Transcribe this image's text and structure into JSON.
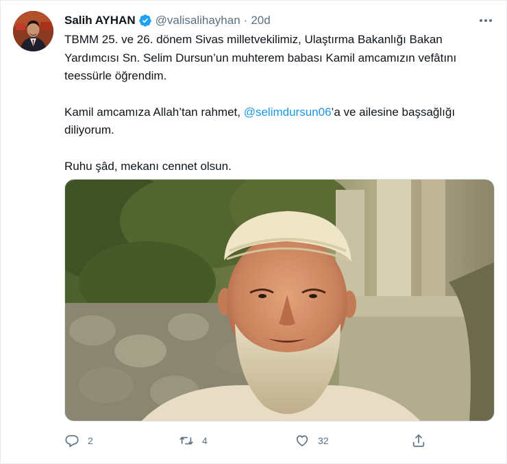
{
  "author": {
    "name": "Salih AYHAN",
    "handle": "@valisalihayhan",
    "separator": "·",
    "time": "20d",
    "verified": true,
    "avatar_icon": "profile-photo"
  },
  "tweet": {
    "paragraph1": "TBMM 25. ve 26. dönem Sivas milletvekilimiz, Ulaştırma Bakanlığı Bakan Yardımcısı Sn. Selim Dursun’un muhterem babası Kamil amcamızın vefâtını teessürle öğrendim.",
    "paragraph2_before": "Kamil amcamıza Allah’tan rahmet, ",
    "paragraph2_mention": "@selimdursun06",
    "paragraph2_after": "’a ve ailesine başsağlığı diliyorum.",
    "paragraph3": "Ruhu şâd, mekanı cennet olsun."
  },
  "actions": {
    "reply_count": "2",
    "retweet_count": "4",
    "like_count": "32",
    "reply_icon": "reply-icon",
    "retweet_icon": "retweet-icon",
    "like_icon": "heart-icon",
    "share_icon": "share-icon"
  },
  "colors": {
    "accent": "#1b95e0",
    "muted": "#5b7083",
    "text": "#0f1419",
    "verified": "#1da1f2"
  }
}
